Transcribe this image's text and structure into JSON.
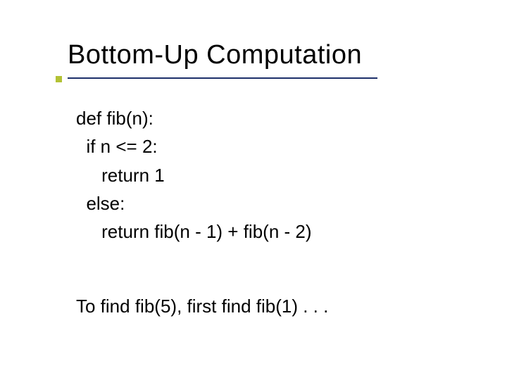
{
  "slide": {
    "title": "Bottom-Up Computation",
    "code": {
      "l1": "def fib(n):",
      "l2": "  if n <= 2:",
      "l3": "     return 1",
      "l4": "  else:",
      "l5": "     return fib(n - 1) + fib(n - 2)"
    },
    "caption": "To find fib(5), first find fib(1) . . ."
  }
}
